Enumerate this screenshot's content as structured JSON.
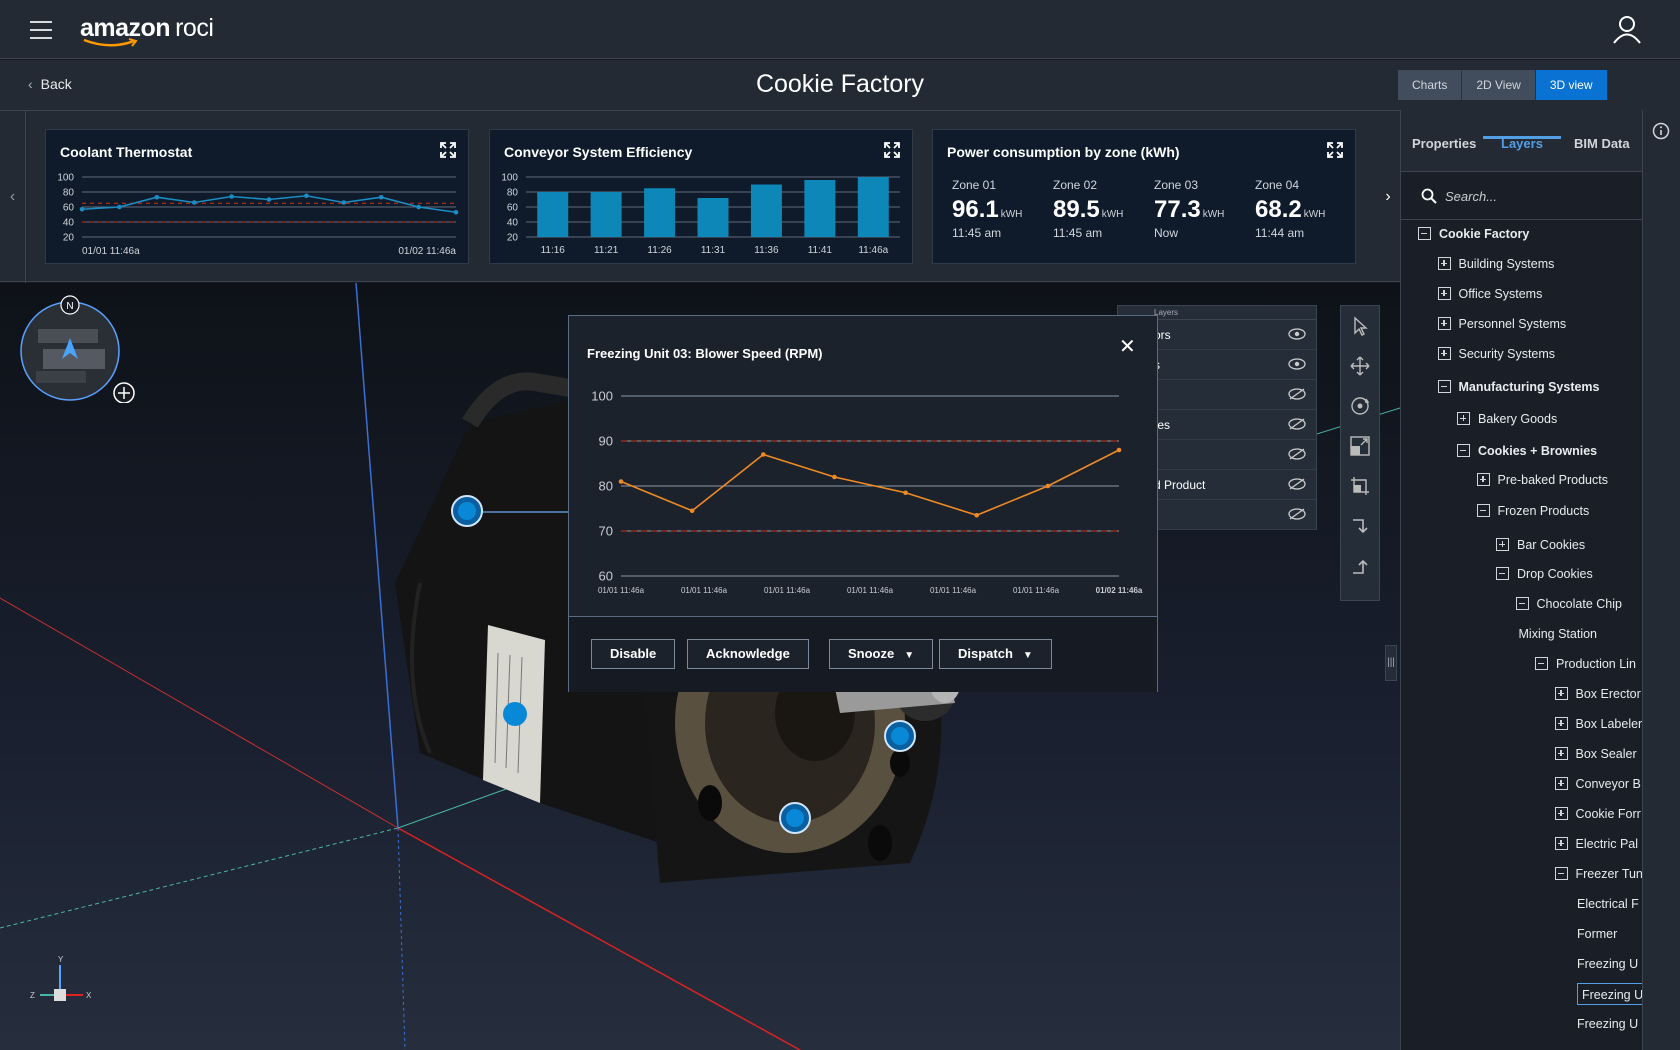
{
  "app": {
    "brand_main": "amazon",
    "brand_sub": "roci"
  },
  "header": {
    "back_label": "Back",
    "title": "Cookie Factory"
  },
  "view_tabs": [
    {
      "label": "Charts",
      "active": false
    },
    {
      "label": "2D View",
      "active": false
    },
    {
      "label": "3D view",
      "active": true
    }
  ],
  "cards": {
    "coolant": {
      "title": "Coolant Thermostat",
      "x_start": "01/01 11:46a",
      "x_end": "01/02 11:46a"
    },
    "conveyor": {
      "title": "Conveyor System Efficiency"
    },
    "power": {
      "title": "Power consumption by zone (kWh)",
      "zones": [
        {
          "name": "Zone 01",
          "value": "96.1",
          "unit": "kWH",
          "time": "11:45 am"
        },
        {
          "name": "Zone 02",
          "value": "89.5",
          "unit": "kWH",
          "time": "11:45 am"
        },
        {
          "name": "Zone 03",
          "value": "77.3",
          "unit": "kWH",
          "time": "Now"
        },
        {
          "name": "Zone 04",
          "value": "68.2",
          "unit": "kWH",
          "time": "11:44 am"
        }
      ]
    }
  },
  "chart_data": [
    {
      "type": "line",
      "title": "Coolant Thermostat",
      "ylim": [
        20,
        100
      ],
      "yticks": [
        "100",
        "80",
        "60",
        "40",
        "20"
      ],
      "thresholds": [
        65,
        40
      ],
      "x_labels": [
        "01/01 11:46a",
        "01/02 11:46a"
      ],
      "values": [
        57,
        60,
        73,
        66,
        74,
        70,
        75,
        66,
        73,
        60,
        53
      ]
    },
    {
      "type": "bar",
      "title": "Conveyor System Efficiency",
      "ylim": [
        20,
        100
      ],
      "yticks": [
        "100",
        "80",
        "60",
        "40",
        "20"
      ],
      "categories": [
        "11:16",
        "11:21",
        "11:26",
        "11:31",
        "11:36",
        "11:41",
        "11:46a"
      ],
      "values": [
        80,
        80,
        85,
        72,
        90,
        96,
        100
      ]
    },
    {
      "type": "line",
      "title": "Freezing Unit 03: Blower Speed (RPM)",
      "ylim": [
        60,
        100
      ],
      "yticks": [
        "100",
        "90",
        "80",
        "70",
        "60"
      ],
      "thresholds": [
        90,
        70
      ],
      "x_labels": [
        "01/01 11:46a",
        "01/01 11:46a",
        "01/01 11:46a",
        "01/01 11:46a",
        "01/01 11:46a",
        "01/01 11:46a",
        "01/02 11:46a"
      ],
      "values": [
        81,
        74.5,
        87,
        82,
        78.5,
        73.5,
        80,
        88
      ]
    }
  ],
  "popup": {
    "title": "Freezing Unit 03: Blower Speed (RPM)",
    "actions": {
      "disable": "Disable",
      "acknowledge": "Acknowledge",
      "snooze": "Snooze",
      "dispatch": "Dispatch"
    }
  },
  "compass": {
    "north": "N"
  },
  "axes_gizmo": {
    "x": "X",
    "y": "Y",
    "z": "Z"
  },
  "layers_overlay": {
    "header": "Layers",
    "rows": [
      {
        "label": "ors",
        "visible": true
      },
      {
        "label": "s",
        "visible": true
      },
      {
        "label": "",
        "visible": false
      },
      {
        "label": "tes",
        "visible": false
      },
      {
        "label": "",
        "visible": false
      },
      {
        "label": "d Product",
        "visible": false
      },
      {
        "label": "",
        "visible": false
      }
    ]
  },
  "side_panel": {
    "tabs": [
      "Properties",
      "Layers",
      "BIM Data"
    ],
    "active_tab": "Layers",
    "search_placeholder": "Search...",
    "tree": [
      {
        "label": "Cookie Factory",
        "level": 0,
        "toggle": "minus",
        "bold": true
      },
      {
        "label": "Building Systems",
        "level": 1,
        "toggle": "plus"
      },
      {
        "label": "Office Systems",
        "level": 1,
        "toggle": "plus"
      },
      {
        "label": "Personnel Systems",
        "level": 1,
        "toggle": "plus"
      },
      {
        "label": "Security Systems",
        "level": 1,
        "toggle": "plus"
      },
      {
        "label": "Manufacturing Systems",
        "level": 1,
        "toggle": "minus",
        "bold": true
      },
      {
        "label": "Bakery Goods",
        "level": 2,
        "toggle": "plus"
      },
      {
        "label": "Cookies + Brownies",
        "level": 2,
        "toggle": "minus",
        "bold": true
      },
      {
        "label": "Pre-baked Products",
        "level": 3,
        "toggle": "plus"
      },
      {
        "label": "Frozen Products",
        "level": 3,
        "toggle": "minus"
      },
      {
        "label": "Bar Cookies",
        "level": 4,
        "toggle": "plus"
      },
      {
        "label": "Drop Cookies",
        "level": 4,
        "toggle": "minus"
      },
      {
        "label": "Chocolate Chip",
        "level": 5,
        "toggle": "minus"
      },
      {
        "label": "Mixing Station",
        "level": 5,
        "toggle": "none"
      },
      {
        "label": "Production Lin",
        "level": 6,
        "toggle": "minus"
      },
      {
        "label": "Box Erector",
        "level": 7,
        "toggle": "plus"
      },
      {
        "label": "Box Labeler",
        "level": 7,
        "toggle": "plus"
      },
      {
        "label": "Box Sealer",
        "level": 7,
        "toggle": "plus"
      },
      {
        "label": "Conveyor B",
        "level": 7,
        "toggle": "plus"
      },
      {
        "label": "Cookie Forr",
        "level": 7,
        "toggle": "plus"
      },
      {
        "label": "Electric Pal",
        "level": 7,
        "toggle": "plus"
      },
      {
        "label": "Freezer Tun",
        "level": 7,
        "toggle": "minus"
      },
      {
        "label": "Electrical F",
        "level": 8,
        "toggle": "none"
      },
      {
        "label": "Former",
        "level": 8,
        "toggle": "none"
      },
      {
        "label": "Freezing U",
        "level": 8,
        "toggle": "none"
      },
      {
        "label": "Freezing U",
        "level": 8,
        "toggle": "none",
        "selected": true
      },
      {
        "label": "Freezing U",
        "level": 8,
        "toggle": "none"
      }
    ]
  },
  "colors": {
    "accent": "#0972d3",
    "bar": "#0d87b8",
    "line_coolant": "#1b8cc4",
    "line_blower": "#f08a24",
    "threshold": "#d13212"
  }
}
